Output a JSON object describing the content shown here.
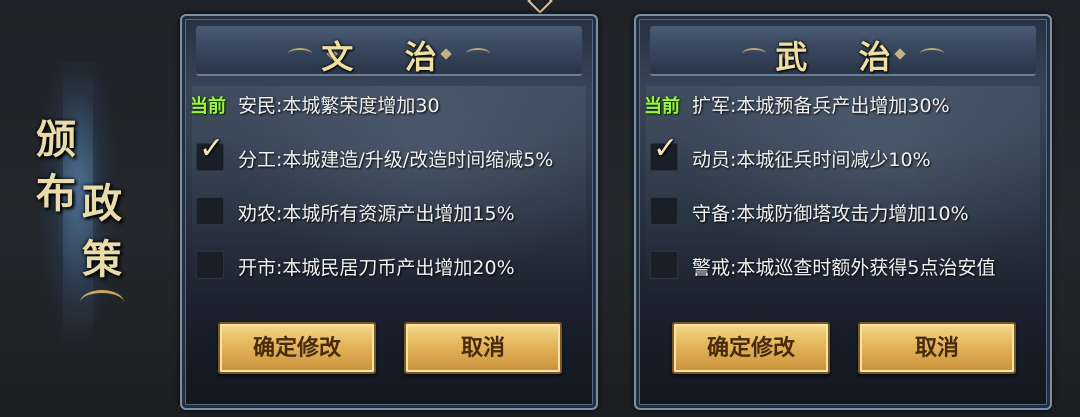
{
  "left_banner": {
    "title_chars": [
      "颁",
      "布",
      "政",
      "策"
    ]
  },
  "panels": [
    {
      "title": "文 治",
      "current_tag": "当前",
      "current_text": "安民:本城繁荣度增加30",
      "options": [
        {
          "text": "分工:本城建造/升级/改造时间缩减5%",
          "checked": true
        },
        {
          "text": "劝农:本城所有资源产出增加15%",
          "checked": false
        },
        {
          "text": "开市:本城民居刀币产出增加20%",
          "checked": false
        }
      ],
      "confirm_label": "确定修改",
      "cancel_label": "取消"
    },
    {
      "title": "武 治",
      "current_tag": "当前",
      "current_text": "扩军:本城预备兵产出增加30%",
      "options": [
        {
          "text": "动员:本城征兵时间减少10%",
          "checked": true
        },
        {
          "text": "守备:本城防御塔攻击力增加10%",
          "checked": false
        },
        {
          "text": "警戒:本城巡查时额外获得5点治安值",
          "checked": false
        }
      ],
      "confirm_label": "确定修改",
      "cancel_label": "取消"
    }
  ],
  "icons": {
    "check": "checkmark-icon"
  },
  "colors": {
    "current_tag": "#9ef04a",
    "button_text": "#4a2a0c",
    "title": "#f0dfa0"
  }
}
